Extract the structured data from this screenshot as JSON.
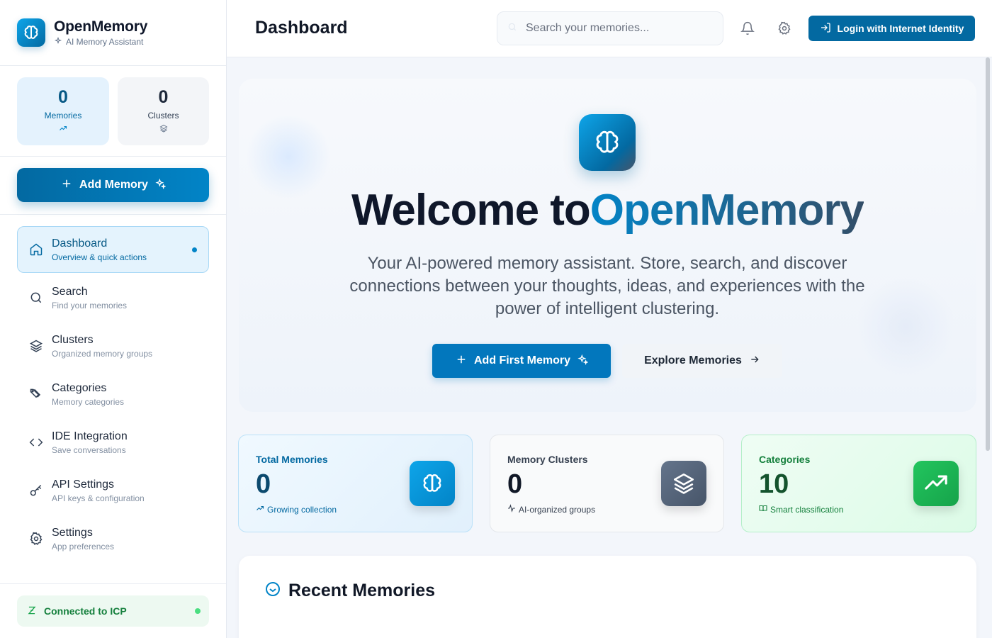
{
  "brand": {
    "title": "OpenMemory",
    "subtitle": "AI Memory Assistant"
  },
  "sidebar_stats": [
    {
      "value": "0",
      "label": "Memories"
    },
    {
      "value": "0",
      "label": "Clusters"
    }
  ],
  "add_memory_label": "Add Memory",
  "nav": [
    {
      "title": "Dashboard",
      "desc": "Overview & quick actions",
      "icon": "home-icon",
      "active": true
    },
    {
      "title": "Search",
      "desc": "Find your memories",
      "icon": "search-icon"
    },
    {
      "title": "Clusters",
      "desc": "Organized memory groups",
      "icon": "layers-icon"
    },
    {
      "title": "Categories",
      "desc": "Memory categories",
      "icon": "tags-icon"
    },
    {
      "title": "IDE Integration",
      "desc": "Save conversations",
      "icon": "code-icon"
    },
    {
      "title": "API Settings",
      "desc": "API keys & configuration",
      "icon": "key-icon"
    },
    {
      "title": "Settings",
      "desc": "App preferences",
      "icon": "gear-icon"
    }
  ],
  "connection_status": "Connected to ICP",
  "topbar": {
    "title": "Dashboard",
    "search_placeholder": "Search your memories...",
    "login_label": "Login with Internet Identity"
  },
  "hero": {
    "title_prefix": "Welcome to",
    "title_accent": "OpenMemory",
    "subtitle": "Your AI-powered memory assistant. Store, search, and discover connections between your thoughts, ideas, and experiences with the power of intelligent clustering.",
    "primary_label": "Add First Memory",
    "secondary_label": "Explore Memories"
  },
  "stat_cards": [
    {
      "label": "Total Memories",
      "value": "0",
      "note": "Growing collection",
      "icon": "brain-icon"
    },
    {
      "label": "Memory Clusters",
      "value": "0",
      "note": "AI-organized groups",
      "icon": "layers-icon"
    },
    {
      "label": "Categories",
      "value": "10",
      "note": "Smart classification",
      "icon": "trending-up-icon"
    }
  ],
  "recent": {
    "title": "Recent Memories"
  },
  "colors": {
    "accent": "#0369a1",
    "accent_light": "#0ea5e9",
    "success": "#16a34a"
  }
}
